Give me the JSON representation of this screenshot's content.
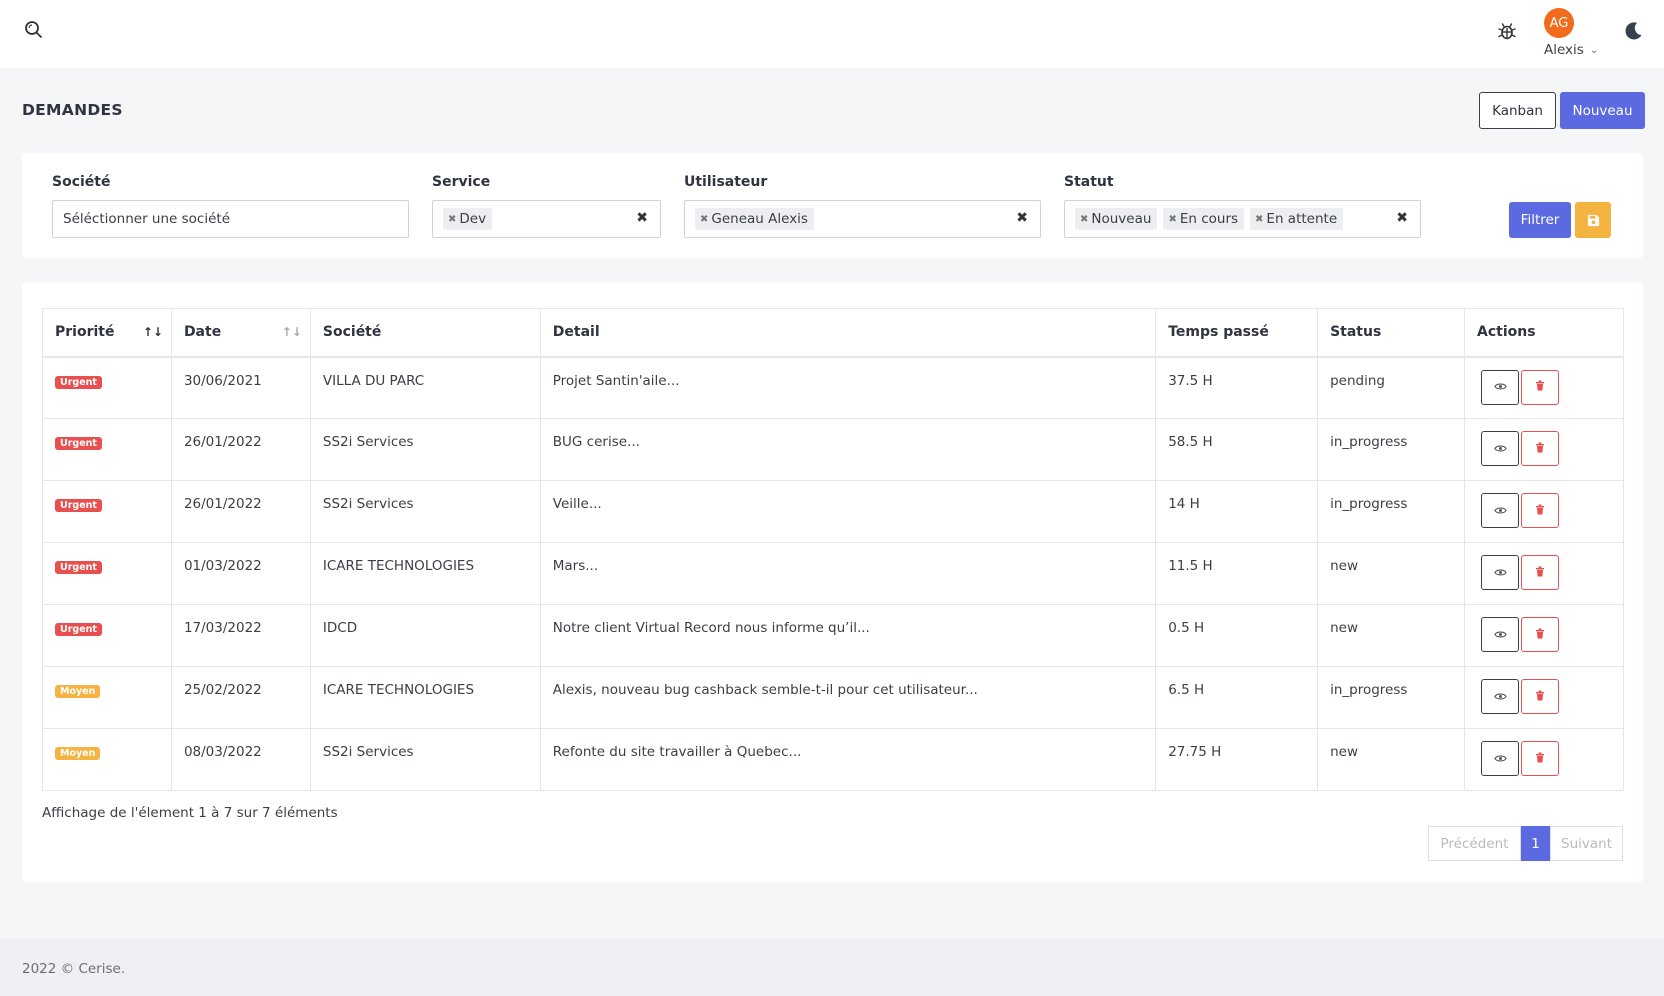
{
  "topbar": {
    "avatar_initials": "AG",
    "user_name": "Alexis",
    "avatar_color": "#f26a1b"
  },
  "page": {
    "title": "DEMANDES",
    "kanban_label": "Kanban",
    "new_label": "Nouveau"
  },
  "filters": {
    "societe": {
      "label": "Société",
      "placeholder": "Séléctionner une société"
    },
    "service": {
      "label": "Service",
      "tags": [
        "Dev"
      ]
    },
    "utilisateur": {
      "label": "Utilisateur",
      "tags": [
        "Geneau Alexis"
      ]
    },
    "statut": {
      "label": "Statut",
      "tags": [
        "Nouveau",
        "En cours",
        "En attente"
      ]
    },
    "filter_label": "Filtrer"
  },
  "table": {
    "headers": [
      "Priorité",
      "Date",
      "Société",
      "Detail",
      "Temps passé",
      "Status",
      "Actions"
    ],
    "rows": [
      {
        "priority": "Urgent",
        "date": "30/06/2021",
        "company": "VILLA DU PARC",
        "detail": "Projet Santin'aile...",
        "time": "37.5 H",
        "status": "pending"
      },
      {
        "priority": "Urgent",
        "date": "26/01/2022",
        "company": "SS2i Services",
        "detail": "BUG cerise...",
        "time": "58.5 H",
        "status": "in_progress"
      },
      {
        "priority": "Urgent",
        "date": "26/01/2022",
        "company": "SS2i Services",
        "detail": "Veille...",
        "time": "14 H",
        "status": "in_progress"
      },
      {
        "priority": "Urgent",
        "date": "01/03/2022",
        "company": "ICARE TECHNOLOGIES",
        "detail": "Mars...",
        "time": "11.5 H",
        "status": "new"
      },
      {
        "priority": "Urgent",
        "date": "17/03/2022",
        "company": "IDCD",
        "detail": "Notre client Virtual Record nous informe qu’il...",
        "time": "0.5 H",
        "status": "new"
      },
      {
        "priority": "Moyen",
        "date": "25/02/2022",
        "company": "ICARE TECHNOLOGIES",
        "detail": "Alexis, nouveau bug cashback semble-t-il pour cet utilisateur...",
        "time": "6.5 H",
        "status": "in_progress"
      },
      {
        "priority": "Moyen",
        "date": "08/03/2022",
        "company": "SS2i Services",
        "detail": "Refonte du site travailler à Quebec...",
        "time": "27.75 H",
        "status": "new"
      }
    ]
  },
  "pagination": {
    "info": "Affichage de l'élement 1 à 7 sur 7 éléments",
    "prev": "Précédent",
    "current": "1",
    "next": "Suivant"
  },
  "footer": {
    "text": "2022 © Cerise."
  }
}
